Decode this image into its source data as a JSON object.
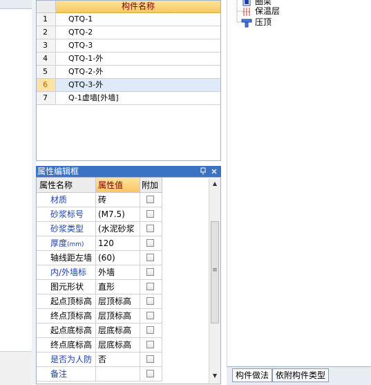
{
  "component_list": {
    "header": "构件名称",
    "rows": [
      {
        "index": "1",
        "name": "QTQ-1"
      },
      {
        "index": "2",
        "name": "QTQ-2"
      },
      {
        "index": "3",
        "name": "QTQ-3"
      },
      {
        "index": "4",
        "name": "QTQ-1-外"
      },
      {
        "index": "5",
        "name": "QTQ-2-外"
      },
      {
        "index": "6",
        "name": "QTQ-3-外"
      },
      {
        "index": "7",
        "name": "Q-1虚墙[外墙]"
      }
    ],
    "selected_index": "6"
  },
  "tree": {
    "items": [
      {
        "label": "圈梁",
        "icon": "beam-icon"
      },
      {
        "label": "保温层",
        "icon": "insulation-icon"
      },
      {
        "label": "压顶",
        "icon": "coping-icon"
      }
    ],
    "tabs": [
      "构件做法",
      "依附构件类型"
    ]
  },
  "property_editor": {
    "title": "属性编辑框",
    "pin_glyph": "ㅁ",
    "close_glyph": "×",
    "columns": {
      "name": "属性名称",
      "value": "属性值",
      "extra": "附加"
    },
    "rows": [
      {
        "name": "材质",
        "value": "砖",
        "blue": true
      },
      {
        "name": "砂浆标号",
        "value": "(M7.5)",
        "blue": true
      },
      {
        "name": "砂浆类型",
        "value": "(水泥砂浆",
        "blue": true
      },
      {
        "name": "厚度",
        "name_unit": "(mm)",
        "value": "120",
        "blue": true
      },
      {
        "name": "轴线距左墙",
        "value": "(60)",
        "blue": false
      },
      {
        "name": "内/外墙标",
        "value": "外墙",
        "blue": true
      },
      {
        "name": "图元形状",
        "value": "直形",
        "blue": false
      },
      {
        "name": "起点顶标高",
        "value": "层顶标高",
        "blue": false
      },
      {
        "name": "终点顶标高",
        "value": "层顶标高",
        "blue": false
      },
      {
        "name": "起点底标高",
        "value": "层底标高",
        "blue": false
      },
      {
        "name": "终点底标高",
        "value": "层底标高",
        "blue": false
      },
      {
        "name": "是否为人防",
        "value": "否",
        "blue": true
      },
      {
        "name": "备注",
        "value": "",
        "blue": true
      }
    ]
  },
  "colors": {
    "accent_blue": "#3a73c4",
    "header_orange": "#f9c75f",
    "label_blue": "#1a3fb0"
  }
}
